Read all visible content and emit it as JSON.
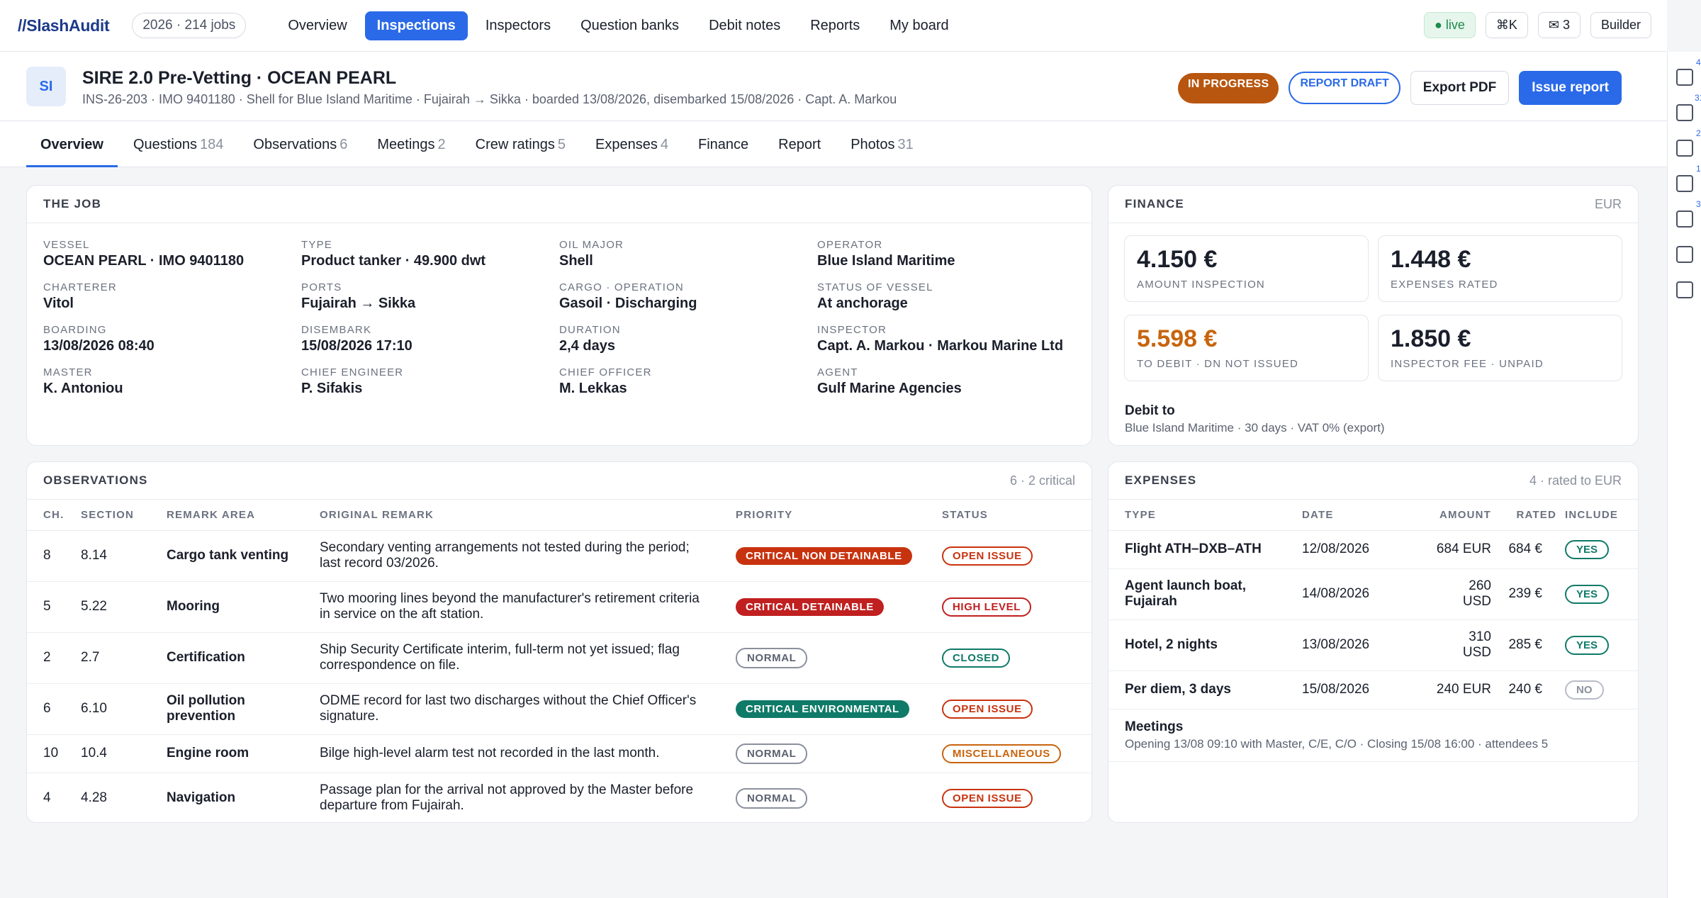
{
  "app": {
    "logo_slash": "//",
    "logo_name": "SlashAudit",
    "year_pill": "2026 · 214 jobs"
  },
  "nav": [
    {
      "label": "Overview",
      "active": false
    },
    {
      "label": "Inspections",
      "active": true
    },
    {
      "label": "Inspectors",
      "active": false
    },
    {
      "label": "Question banks",
      "active": false
    },
    {
      "label": "Debit notes",
      "active": false
    },
    {
      "label": "Reports",
      "active": false
    },
    {
      "label": "My board",
      "active": false
    }
  ],
  "topright": {
    "live": "● live",
    "cmdk": "⌘K",
    "mail": "✉ 3",
    "builder": "Builder"
  },
  "job": {
    "avatar": "SI",
    "title": "SIRE 2.0 Pre-Vetting · OCEAN PEARL",
    "subtitle": "INS-26-203 · IMO 9401180 · Shell for Blue Island Maritime · Fujairah → Sikka · boarded 13/08/2026, disembarked 15/08/2026 · Capt. A. Markou",
    "status_badge": "IN PROGRESS",
    "draft_badge": "REPORT DRAFT",
    "export_label": "Export PDF",
    "issue_label": "Issue report"
  },
  "tabs": [
    {
      "label": "Overview",
      "count": ""
    },
    {
      "label": "Questions",
      "count": "184"
    },
    {
      "label": "Observations",
      "count": "6"
    },
    {
      "label": "Meetings",
      "count": "2"
    },
    {
      "label": "Crew ratings",
      "count": "5"
    },
    {
      "label": "Expenses",
      "count": "4"
    },
    {
      "label": "Finance",
      "count": ""
    },
    {
      "label": "Report",
      "count": ""
    },
    {
      "label": "Photos",
      "count": "31"
    }
  ],
  "the_job": {
    "heading": "THE JOB",
    "fields": [
      {
        "label": "Vessel",
        "value": "OCEAN PEARL · IMO 9401180"
      },
      {
        "label": "Type",
        "value": "Product tanker · 49.900 dwt"
      },
      {
        "label": "Oil major",
        "value": "Shell"
      },
      {
        "label": "Operator",
        "value": "Blue Island Maritime"
      },
      {
        "label": "Charterer",
        "value": "Vitol"
      },
      {
        "label": "Ports",
        "value": "Fujairah → Sikka"
      },
      {
        "label": "Cargo · operation",
        "value": "Gasoil · Discharging"
      },
      {
        "label": "Status of vessel",
        "value": "At anchorage"
      },
      {
        "label": "Boarding",
        "value": "13/08/2026 08:40"
      },
      {
        "label": "Disembark",
        "value": "15/08/2026 17:10"
      },
      {
        "label": "Duration",
        "value": "2,4 days"
      },
      {
        "label": "Inspector",
        "value": "Capt. A. Markou · Markou Marine Ltd"
      },
      {
        "label": "Master",
        "value": "K. Antoniou"
      },
      {
        "label": "Chief engineer",
        "value": "P. Sifakis"
      },
      {
        "label": "Chief officer",
        "value": "M. Lekkas"
      },
      {
        "label": "Agent",
        "value": "Gulf Marine Agencies"
      }
    ]
  },
  "finance": {
    "heading": "FINANCE",
    "currency": "EUR",
    "boxes": [
      {
        "value": "4.150 €",
        "label": "AMOUNT INSPECTION"
      },
      {
        "value": "1.448 €",
        "label": "EXPENSES RATED"
      },
      {
        "value": "5.598 €",
        "label": "TO DEBIT · DN NOT ISSUED"
      },
      {
        "value": "1.850 €",
        "label": "INSPECTOR FEE · UNPAID"
      }
    ],
    "debit_title": "Debit to",
    "debit_detail": "Blue Island Maritime · 30 days · VAT 0% (export)"
  },
  "observations": {
    "heading": "OBSERVATIONS",
    "summary": "6 · 2 critical",
    "columns": [
      "CH.",
      "SECTION",
      "REMARK AREA",
      "ORIGINAL REMARK",
      "PRIORITY",
      "STATUS"
    ],
    "rows": [
      {
        "ch": "8",
        "section": "8.14",
        "area": "Cargo tank venting",
        "remark": "Secondary venting arrangements not tested during the period; last record 03/2026.",
        "priority": "CRITICAL NON DETAINABLE",
        "status": "OPEN ISSUE"
      },
      {
        "ch": "5",
        "section": "5.22",
        "area": "Mooring",
        "remark": "Two mooring lines beyond the manufacturer's retirement criteria in service on the aft station.",
        "priority": "CRITICAL DETAINABLE",
        "status": "HIGH LEVEL"
      },
      {
        "ch": "2",
        "section": "2.7",
        "area": "Certification",
        "remark": "Ship Security Certificate interim, full-term not yet issued; flag correspondence on file.",
        "priority": "NORMAL",
        "status": "CLOSED"
      },
      {
        "ch": "6",
        "section": "6.10",
        "area": "Oil pollution prevention",
        "remark": "ODME record for last two discharges without the Chief Officer's signature.",
        "priority": "CRITICAL ENVIRONMENTAL",
        "status": "OPEN ISSUE"
      },
      {
        "ch": "10",
        "section": "10.4",
        "area": "Engine room",
        "remark": "Bilge high-level alarm test not recorded in the last month.",
        "priority": "NORMAL",
        "status": "MISCELLANEOUS"
      },
      {
        "ch": "4",
        "section": "4.28",
        "area": "Navigation",
        "remark": "Passage plan for the arrival not approved by the Master before departure from Fujairah.",
        "priority": "NORMAL",
        "status": "OPEN ISSUE"
      }
    ]
  },
  "expenses": {
    "heading": "EXPENSES",
    "summary": "4 · rated to EUR",
    "columns": [
      "TYPE",
      "DATE",
      "AMOUNT",
      "RATED",
      "INCLUDE"
    ],
    "rows": [
      {
        "type": "Flight ATH–DXB–ATH",
        "date": "12/08/2026",
        "amount": "684 EUR",
        "rated": "684 €",
        "include": "YES"
      },
      {
        "type": "Agent launch boat, Fujairah",
        "date": "14/08/2026",
        "amount": "260 USD",
        "rated": "239 €",
        "include": "YES"
      },
      {
        "type": "Hotel, 2 nights",
        "date": "13/08/2026",
        "amount": "310 USD",
        "rated": "285 €",
        "include": "YES"
      },
      {
        "type": "Per diem, 3 days",
        "date": "15/08/2026",
        "amount": "240 EUR",
        "rated": "240 €",
        "include": "NO"
      }
    ],
    "meetings_title": "Meetings",
    "meetings_detail": "Opening 13/08 09:10 with Master, C/E, C/O · Closing 15/08 16:00 · attendees 5"
  },
  "side_marks": [
    "4",
    "31",
    "2",
    "1",
    "3"
  ]
}
